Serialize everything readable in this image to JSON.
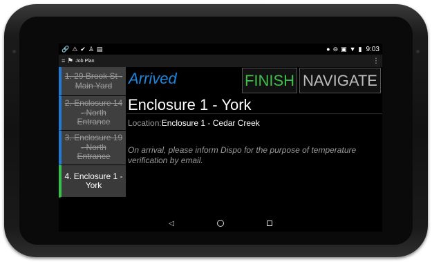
{
  "status_bar": {
    "left_icons": [
      "link-icon",
      "warning-icon",
      "check-circle-icon",
      "account-icon",
      "clipboard-icon"
    ],
    "right_icons": [
      "location-pin-icon",
      "do-not-disturb-icon",
      "bus-icon",
      "wifi-icon",
      "battery-icon"
    ],
    "time": "9:03"
  },
  "app_bar": {
    "title": "Job Plan"
  },
  "stops": [
    {
      "label": "1. 29 Brook St - Main Yard",
      "completed": true
    },
    {
      "label": "2. Enclosure 14 - North Entrance",
      "completed": true
    },
    {
      "label": "3. Enclosure 19 - North Entrance",
      "completed": true
    },
    {
      "label": "4. Enclosure 1 - York",
      "completed": false
    }
  ],
  "main": {
    "status": "Arrived",
    "finish_label": "FINISH",
    "navigate_label": "NAVIGATE",
    "stop_name": "Enclosure 1 - York",
    "location_label": "Location:",
    "location_value": "Enclosure 1 - Cedar Creek",
    "note": "On arrival, please inform Dispo for the purpose of temperature verification by email."
  },
  "colors": {
    "accent_blue": "#1e86e0",
    "finish_green": "#3fbf4a",
    "completed_stop_bar": "#1e7bd6",
    "current_stop_bar": "#34c24a"
  }
}
